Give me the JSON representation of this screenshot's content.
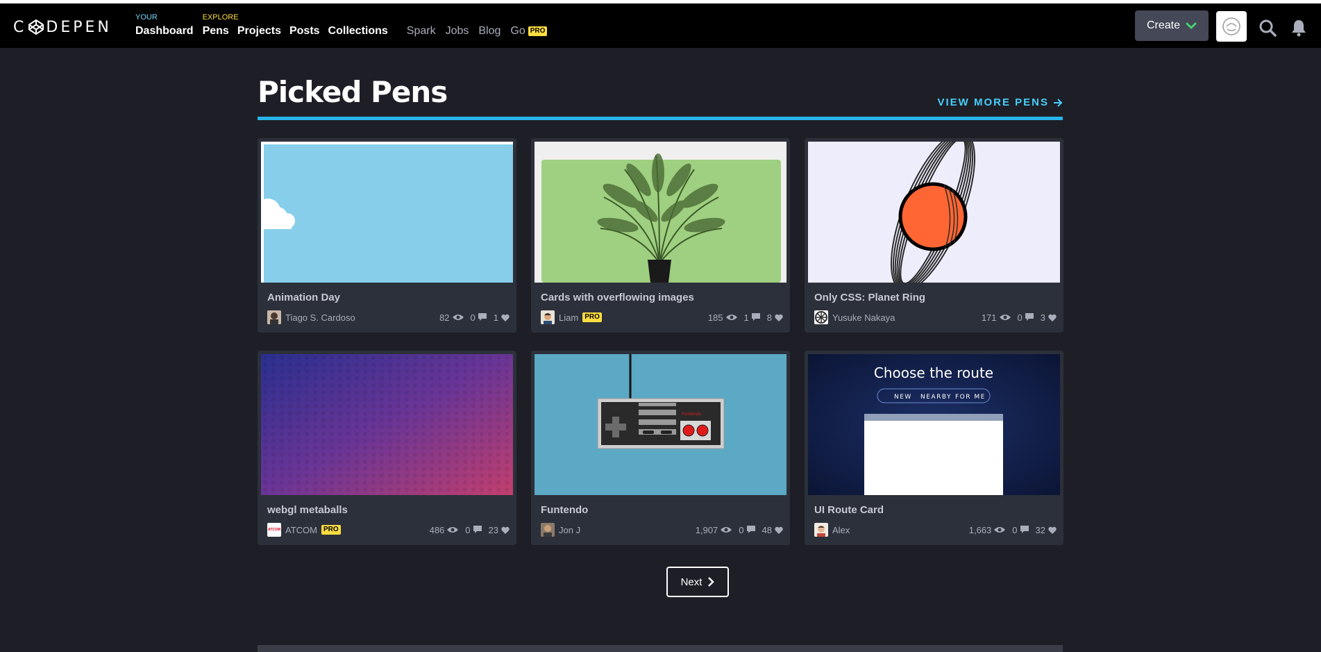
{
  "brand": {
    "logo_text": "DEPEN",
    "logo_prefix": "C"
  },
  "nav": {
    "your_label": "YOUR",
    "dashboard": "Dashboard",
    "explore_label": "EXPLORE",
    "pens": "Pens",
    "projects": "Projects",
    "posts": "Posts",
    "collections": "Collections",
    "spark": "Spark",
    "jobs": "Jobs",
    "blog": "Blog",
    "go": "Go",
    "go_badge": "PRO"
  },
  "header": {
    "create_label": "Create"
  },
  "section": {
    "title": "Picked Pens",
    "view_more": "VIEW MORE PENS"
  },
  "cards": [
    {
      "title": "Animation Day",
      "author": "Tiago S. Cardoso",
      "pro": false,
      "views": "82",
      "comments": "0",
      "likes": "1"
    },
    {
      "title": "Cards with overflowing images",
      "author": "Liam",
      "pro": true,
      "pro_label": "PRO",
      "views": "185",
      "comments": "1",
      "likes": "8"
    },
    {
      "title": "Only CSS: Planet Ring",
      "author": "Yusuke Nakaya",
      "pro": false,
      "views": "171",
      "comments": "0",
      "likes": "3"
    },
    {
      "title": "webgl metaballs",
      "author": "ATCOM",
      "pro": true,
      "pro_label": "PRO",
      "views": "486",
      "comments": "0",
      "likes": "23"
    },
    {
      "title": "Funtendo",
      "author": "Jon J",
      "pro": false,
      "views": "1,907",
      "comments": "0",
      "likes": "48"
    },
    {
      "title": "UI Route Card",
      "author": "Alex",
      "pro": false,
      "views": "1,663",
      "comments": "0",
      "likes": "32"
    }
  ],
  "previews": {
    "route_card": {
      "heading": "Choose the route",
      "tabs": [
        "NEW",
        "NEARBY",
        "FOR ME"
      ]
    },
    "funtendo": {
      "brand": "Funtendo"
    },
    "atcom_avatar": "ATCOM"
  },
  "pagination": {
    "next_label": "Next"
  },
  "colors": {
    "background": "#1e1f26",
    "header": "#000000",
    "card": "#2c303a",
    "accent_blue": "#47cfff",
    "pro_yellow": "#ffdd40"
  },
  "icons": [
    "codepen-logo-icon",
    "chevron-down-icon",
    "search-icon",
    "bell-icon",
    "eye-icon",
    "comment-icon",
    "heart-icon",
    "arrow-right-icon",
    "chevron-right-icon"
  ]
}
